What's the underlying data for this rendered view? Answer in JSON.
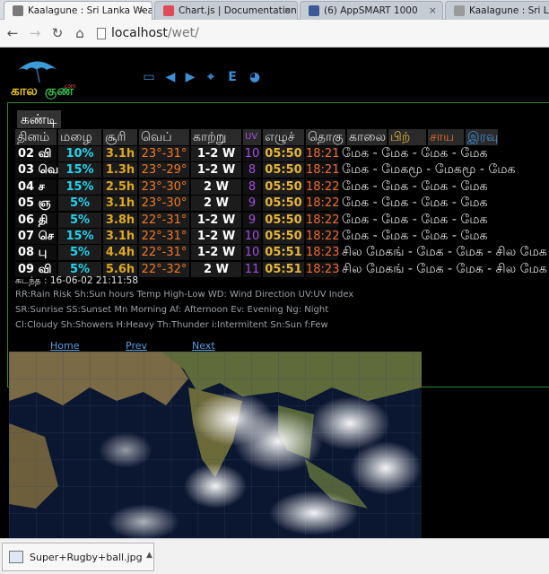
{
  "browser": {
    "tabs": [
      {
        "title": "Kaalagune : Sri Lanka Wea",
        "favicon_color": "#7a7a7a",
        "active": true
      },
      {
        "title": "Chart.js | Documentation",
        "favicon_color": "#e04b5b",
        "active": false
      },
      {
        "title": "(6) AppSMART 1000",
        "favicon_color": "#3b5998",
        "active": false
      },
      {
        "title": "Kaalagune : Sri Lanka",
        "favicon_color": "#9a9a9a",
        "active": false
      }
    ],
    "close_glyph": "×",
    "back_icon": "←",
    "forward_icon": "→",
    "reload_icon": "↻",
    "home_icon": "⌂",
    "url_host": "localhost",
    "url_path": "/wet/"
  },
  "site": {
    "logo_text": "காலகுணம்",
    "logo_sub": ".com",
    "toolbar_icons": [
      {
        "name": "chart-icon",
        "glyph": "▭"
      },
      {
        "name": "prev-arrow-icon",
        "glyph": "◀"
      },
      {
        "name": "next-arrow-icon",
        "glyph": "▶"
      },
      {
        "name": "map-pin-icon",
        "glyph": "⌖"
      },
      {
        "name": "english-toggle-icon",
        "glyph": "E"
      },
      {
        "name": "dashboard-icon",
        "glyph": "◕"
      }
    ]
  },
  "forecast": {
    "city": "கண்டி",
    "headers": [
      "தினம்",
      "மழை",
      "சூரி",
      "வெப்",
      "காற்று",
      "UV",
      "எழுச்",
      "தொகு",
      "காலை",
      "பிற்",
      "சாய",
      "இரவு"
    ],
    "header_colors": [
      "#ddd",
      "#ddd",
      "#ddd",
      "#ddd",
      "#ddd",
      "#a24ee0",
      "#ddd",
      "#ddd",
      "#ddd",
      "#e6b53a",
      "#ef6a2a",
      "#3e8ed8"
    ],
    "rows": [
      {
        "day": "02 வி",
        "rain": "10%",
        "sun": "3.1h",
        "temp": "23°-31°",
        "wind": "1-2 W",
        "uv": "10",
        "sunrise": "05:50",
        "sunset": "18:21",
        "forecast": "மேக - மேக - மேக - மேக"
      },
      {
        "day": "03 வெ",
        "rain": "15%",
        "sun": "1.3h",
        "temp": "23°-29°",
        "wind": "1-2 W",
        "uv": "8",
        "sunrise": "05:50",
        "sunset": "18:21",
        "forecast": "மேக - மேகமூ - மேகமூ - மேக"
      },
      {
        "day": "04 ச",
        "rain": "15%",
        "sun": "2.5h",
        "temp": "23°-30°",
        "wind": "2 W",
        "uv": "8",
        "sunrise": "05:50",
        "sunset": "18:22",
        "forecast": "மேக - மேக - மேக - மேக"
      },
      {
        "day": "05 ஞ",
        "rain": "5%",
        "sun": "3.1h",
        "temp": "23°-30°",
        "wind": "2 W",
        "uv": "9",
        "sunrise": "05:50",
        "sunset": "18:22",
        "forecast": "மேக - மேக - மேக - மேக"
      },
      {
        "day": "06 தி",
        "rain": "5%",
        "sun": "3.8h",
        "temp": "22°-31°",
        "wind": "1-2 W",
        "uv": "9",
        "sunrise": "05:50",
        "sunset": "18:22",
        "forecast": "மேக - மேக - மேக - மேக"
      },
      {
        "day": "07 செ",
        "rain": "15%",
        "sun": "3.1h",
        "temp": "22°-31°",
        "wind": "1-2 W",
        "uv": "10",
        "sunrise": "05:50",
        "sunset": "18:22",
        "forecast": "மேக - மேக - மேக - மேக"
      },
      {
        "day": "08 பு",
        "rain": "5%",
        "sun": "4.4h",
        "temp": "22°-31°",
        "wind": "1-2 W",
        "uv": "10",
        "sunrise": "05:51",
        "sunset": "18:23",
        "forecast": "சில மேகங் - மேக - மேக - சில மேக"
      },
      {
        "day": "09 வி",
        "rain": "5%",
        "sun": "5.6h",
        "temp": "22°-32°",
        "wind": "2 W",
        "uv": "11",
        "sunrise": "05:51",
        "sunset": "18:23",
        "forecast": "சில மேகங் - மேக - மேக - சில மேக"
      }
    ],
    "updated": "கடந்த : 16-06-02 21:11:58",
    "legend_lines": [
      "RR:Rain Risk Sh:Sun hours Temp High-Low WD: Wind Direction UV:UV Index",
      "SR:Sunrise SS:Sunset Mn Morning Af: Afternoon Ev: Evening Ng: Night",
      "Cl:Cloudy Sh:Showers H:Heavy Th:Thunder i:Intermitent Sn:Sun f:Few"
    ]
  },
  "nav_links": {
    "home": "Home",
    "prev": "Prev",
    "next": "Next"
  },
  "download": {
    "filename": "Super+Rugby+ball.jpg",
    "menu_glyph": "▲"
  },
  "colors": {
    "panel_border": "#2f8a2f",
    "rain": "#22d3ee",
    "sun": "#e0a81e",
    "temp": "#f07822",
    "uv": "#a24ee0",
    "sunset": "#ef6a2a",
    "link": "#5a9ee8"
  }
}
